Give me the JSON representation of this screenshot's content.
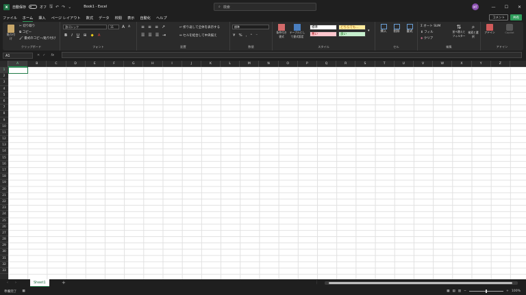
{
  "title": {
    "autosave_label": "自動保存",
    "autosave_state": "オフ",
    "doc_title": "Book1 - Excel",
    "search_placeholder": "検索",
    "avatar_initials": "MT"
  },
  "tabs": [
    "ファイル",
    "ホーム",
    "挿入",
    "ページ レイアウト",
    "数式",
    "データ",
    "校閲",
    "表示",
    "自動化",
    "ヘルプ"
  ],
  "active_tab": "ホーム",
  "actions": {
    "comment": "コメント",
    "share": "共有"
  },
  "ribbon": {
    "clipboard": {
      "label": "クリップボード",
      "paste": "貼り付け",
      "cut": "切り取り",
      "copy": "コピー",
      "format_painter": "書式のコピー/貼り付け"
    },
    "font": {
      "label": "フォント",
      "font_name": "游ゴシック",
      "font_size": "11",
      "grow": "A",
      "shrink": "A"
    },
    "alignment": {
      "label": "配置",
      "wrap": "折り返して全体を表示する",
      "merge": "セルを結合して中央揃え"
    },
    "number": {
      "label": "数値",
      "format": "標準"
    },
    "styles": {
      "label": "スタイル",
      "cond": "条件付き書式",
      "table": "テーブルとして書式設定",
      "normal": "標準",
      "neutral": "どちらでも...",
      "bad": "悪い",
      "good": "良い"
    },
    "cells": {
      "label": "セル",
      "insert": "挿入",
      "delete": "削除",
      "format": "書式"
    },
    "editing": {
      "label": "編集",
      "autosum": "オート SUM",
      "fill": "フィル",
      "clear": "クリア",
      "sort": "並べ替えとフィルター",
      "find": "検索と選択"
    },
    "addins": {
      "label": "アドイン",
      "addin": "アドイン",
      "copilot": "Copilot"
    }
  },
  "formula_bar": {
    "name_box": "A1",
    "fx": "fx"
  },
  "columns": [
    "A",
    "B",
    "C",
    "D",
    "E",
    "F",
    "G",
    "H",
    "I",
    "J",
    "K",
    "L",
    "M",
    "N",
    "O",
    "P",
    "Q",
    "R",
    "S",
    "T",
    "U",
    "V",
    "W",
    "X",
    "Y",
    "Z"
  ],
  "rows": [
    "1",
    "2",
    "3",
    "4",
    "5",
    "6",
    "7",
    "8",
    "9",
    "10",
    "11",
    "12",
    "13",
    "14",
    "15",
    "16",
    "17",
    "18",
    "19",
    "20",
    "21",
    "22",
    "23",
    "24",
    "25",
    "26",
    "27",
    "28",
    "29",
    "30",
    "31",
    "32",
    "33"
  ],
  "sheet": {
    "name": "Sheet1",
    "add": "+"
  },
  "status": {
    "ready": "準備完了",
    "zoom": "100%"
  },
  "colors": {
    "accent": "#2e9c5a",
    "excel_green": "#1d6f42"
  }
}
